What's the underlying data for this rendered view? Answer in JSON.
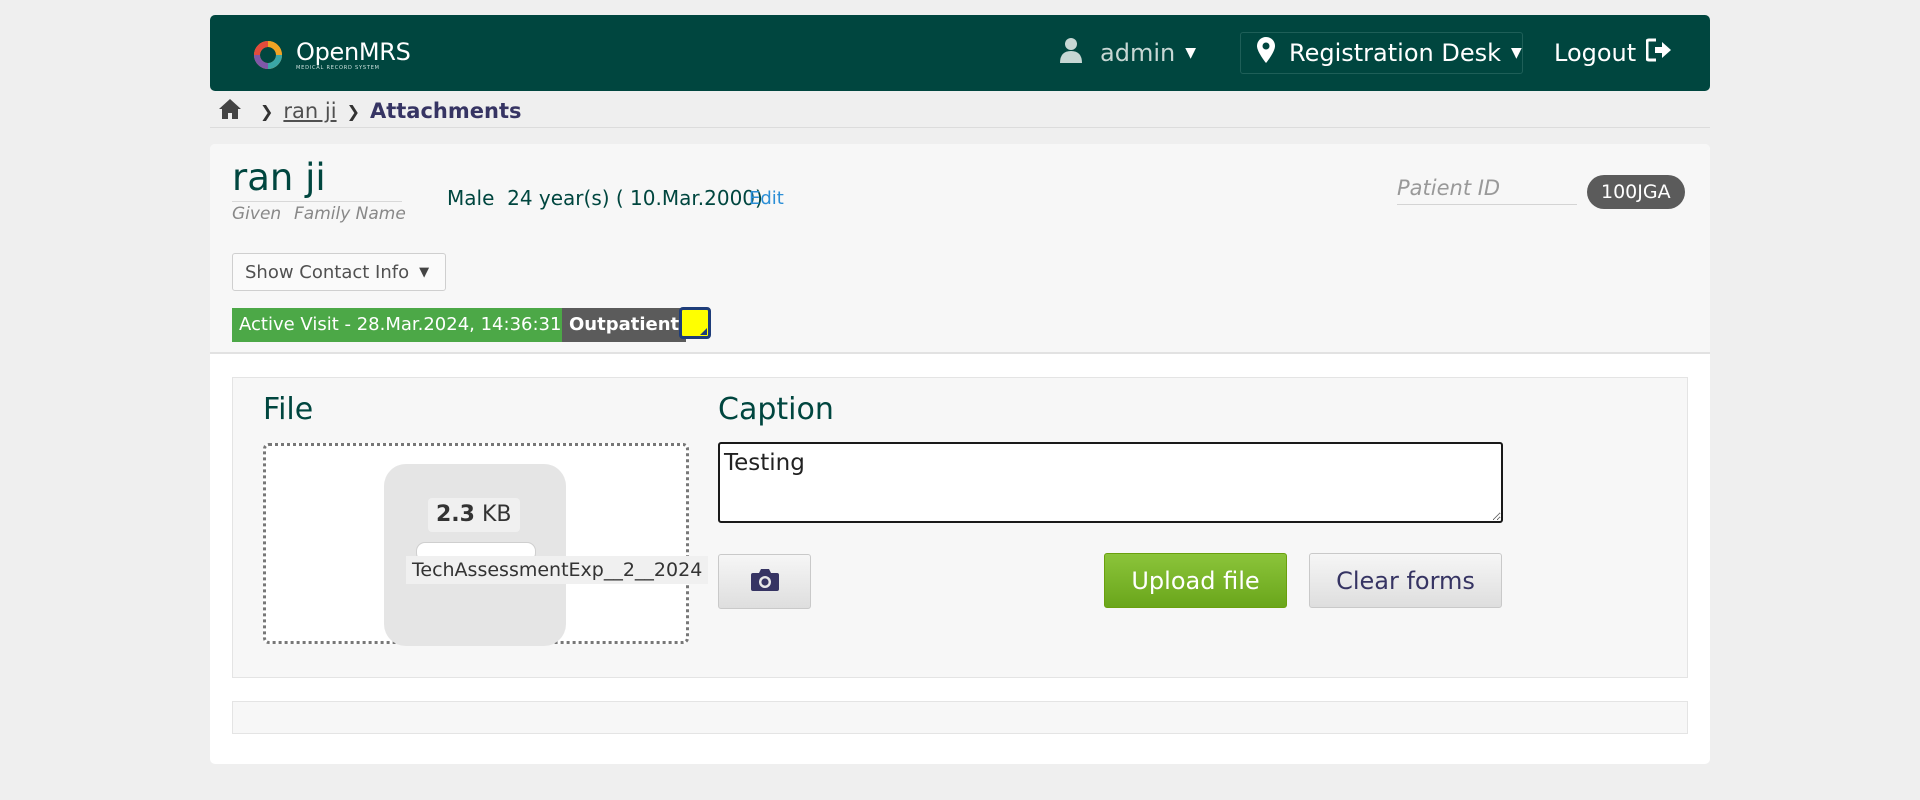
{
  "header": {
    "logo": {
      "name": "OpenMRS",
      "tagline": "MEDICAL RECORD SYSTEM"
    },
    "user": {
      "name": "admin",
      "icon": "user-icon"
    },
    "location": {
      "name": "Registration Desk",
      "icon": "map-marker-icon"
    },
    "logout_label": "Logout"
  },
  "breadcrumb": {
    "patient": "ran ji",
    "current": "Attachments"
  },
  "patient": {
    "given_name": "ran ji",
    "given_label": "Given",
    "family_label": "Family Name",
    "demographics": "Male  24 year(s) ( 10.Mar.2000)",
    "edit_label": "Edit",
    "id_label": "Patient ID",
    "id_value": "100JGA",
    "contact_button": "Show Contact Info",
    "visit_badge": "Active Visit - 28.Mar.2024, 14:36:31",
    "visit_type": "Outpatient"
  },
  "upload": {
    "file_label": "File",
    "file_size_value": "2.3",
    "file_size_unit": "KB",
    "file_name": "TechAssessmentExp__2__2024",
    "caption_label": "Caption",
    "caption_value": "Testing",
    "upload_button": "Upload file",
    "clear_button": "Clear forms"
  },
  "colors": {
    "header_bg": "#00463f",
    "visit_green": "#4ca847",
    "upload_green": "#7ab52a",
    "link_blue": "#2a8ed6"
  }
}
